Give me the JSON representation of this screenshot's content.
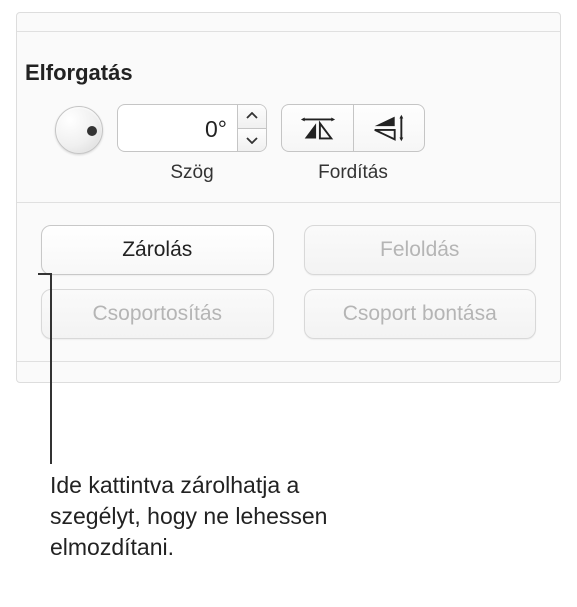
{
  "section": {
    "title": "Elforgatás",
    "angle_label": "Szög",
    "flip_label": "Fordítás",
    "angle_value": "0°"
  },
  "buttons": {
    "lock": "Zárolás",
    "unlock": "Feloldás",
    "group": "Csoportosítás",
    "ungroup": "Csoport bontása"
  },
  "callout": {
    "text": "Ide kattintva zárolhatja a szegélyt, hogy ne lehessen elmozdítani."
  }
}
